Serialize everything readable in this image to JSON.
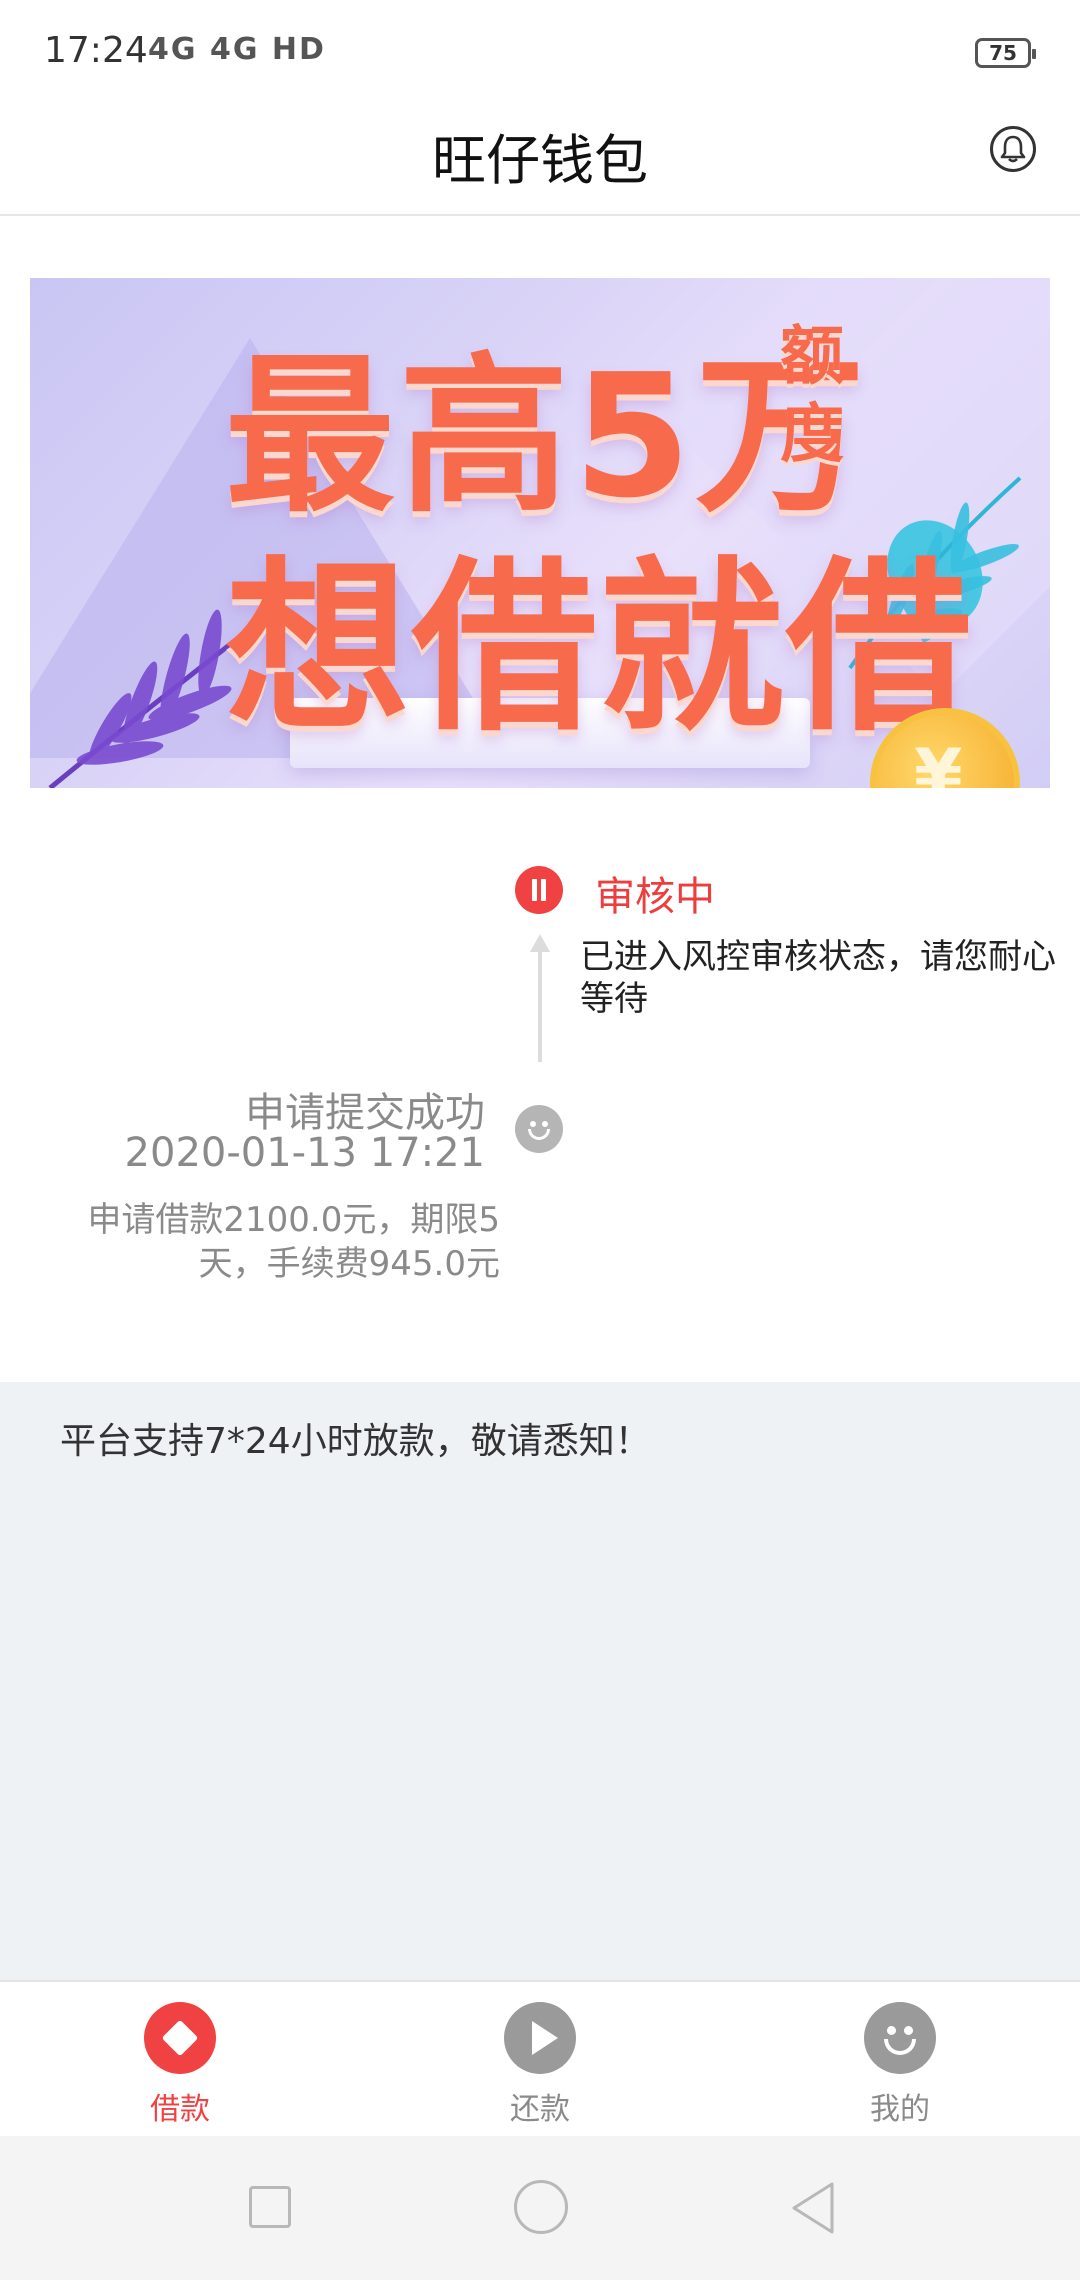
{
  "status_bar": {
    "time": "17:24",
    "signal": "4G 4G HD",
    "battery": "75"
  },
  "header": {
    "title": "旺仔钱包",
    "bell_icon": "bell-icon"
  },
  "banner": {
    "line1": "最高5万",
    "side": "额度",
    "line2": "想借就借",
    "coin": "¥"
  },
  "timeline": {
    "current": {
      "title": "审核中",
      "description": "已进入风控审核状态，请您耐心等待",
      "icon": "pause-icon",
      "color": "#f04242"
    },
    "submitted": {
      "title": "申请提交成功",
      "time": "2020-01-13 17:21",
      "detail": "申请借款2100.0元，期限5天，手续费945.0元",
      "icon": "smiley-icon"
    }
  },
  "notice": {
    "text": "平台支持7*24小时放款，敬请悉知！"
  },
  "bottom_nav": {
    "items": [
      {
        "label": "借款",
        "icon": "diamond-icon",
        "active": true
      },
      {
        "label": "还款",
        "icon": "play-icon",
        "active": false
      },
      {
        "label": "我的",
        "icon": "smiley-icon",
        "active": false
      }
    ],
    "active_color": "#f04242",
    "inactive_color": "#8a8a8a"
  }
}
